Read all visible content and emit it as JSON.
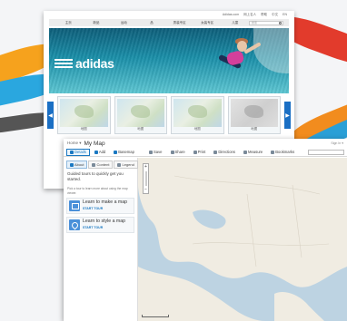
{
  "website": {
    "top_links": [
      "Adidas.com",
      "网上名人",
      "帮助",
      "中文",
      "EN"
    ],
    "nav": [
      "主页",
      "新品",
      "运动",
      "品",
      "男装专区",
      "女装专区",
      "儿童"
    ],
    "search_placeholder": "搜索",
    "banner_brand": "adidas",
    "thumb_captions": [
      "地图",
      "地图",
      "地图",
      "地图"
    ],
    "colors": {
      "brand_blue": "#1a6fc4",
      "banner_top": "#0e5e7a",
      "banner_bottom": "#5ec7d3"
    }
  },
  "map_app": {
    "breadcrumb": "Home ▾",
    "title": "My Map",
    "user": "Sign In ▾",
    "toolbar": {
      "details": "Details",
      "add": "Add",
      "basemap": "Basemap",
      "save": "Save",
      "share": "Share",
      "print": "Print",
      "directions": "Directions",
      "measure": "Measure",
      "bookmarks": "Bookmarks"
    },
    "side_tabs": [
      "About",
      "Content",
      "Legend"
    ],
    "lead": "Guided tours to quickly get you started.",
    "hint": "Pick a tour to learn more about using the map viewer.",
    "cards": [
      {
        "title": "Learn to make a map",
        "link": "START TOUR",
        "icon": "map-icon"
      },
      {
        "title": "Learn to style a map",
        "link": "START TOUR",
        "icon": "pin-icon"
      }
    ],
    "zoom": {
      "in": "+",
      "out": "−"
    },
    "colors": {
      "accent": "#1a78c2",
      "land": "#f0ece2",
      "water": "#bdd3e2"
    }
  }
}
